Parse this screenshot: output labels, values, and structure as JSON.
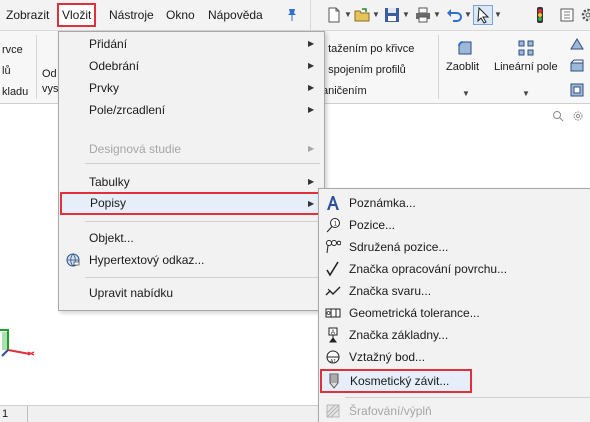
{
  "menubar": {
    "items": [
      {
        "label": "Zobrazit"
      },
      {
        "label": "Vložit"
      },
      {
        "label": "Nástroje"
      },
      {
        "label": "Okno"
      },
      {
        "label": "Nápověda"
      }
    ]
  },
  "ribbon": {
    "left_fragments": [
      "rvce",
      "lů",
      "kladu"
    ],
    "odv": [
      "Od",
      "vys"
    ],
    "fragments": [
      "í tažením po křivce",
      "í spojením profilů",
      "aničením"
    ],
    "commands": [
      {
        "label": "Zaoblit"
      },
      {
        "label": "Lineární pole"
      }
    ]
  },
  "insert_menu": {
    "items": [
      {
        "label": "Přidání",
        "submenu": true,
        "disabled": false
      },
      {
        "label": "Odebrání",
        "submenu": true,
        "disabled": false
      },
      {
        "label": "Prvky",
        "submenu": true,
        "disabled": false
      },
      {
        "label": "Pole/zrcadlení",
        "submenu": true,
        "disabled": false
      },
      {
        "label": "Designová studie",
        "submenu": true,
        "disabled": true
      },
      {
        "label": "Tabulky",
        "submenu": true,
        "disabled": false
      },
      {
        "label": "Popisy",
        "submenu": true,
        "disabled": false,
        "highlighted": true
      },
      {
        "label": "Objekt...",
        "submenu": false,
        "disabled": false
      },
      {
        "label": "Hypertextový odkaz...",
        "submenu": false,
        "disabled": false
      },
      {
        "label": "Upravit nabídku",
        "submenu": false,
        "disabled": false
      }
    ]
  },
  "annotations_menu": {
    "items": [
      {
        "label": "Poznámka...",
        "icon": "note-icon"
      },
      {
        "label": "Pozice...",
        "icon": "balloon-icon"
      },
      {
        "label": "Sdružená pozice...",
        "icon": "stacked-balloon-icon"
      },
      {
        "label": "Značka opracování povrchu...",
        "icon": "surface-finish-icon"
      },
      {
        "label": "Značka svaru...",
        "icon": "weld-symbol-icon"
      },
      {
        "label": "Geometrická tolerance...",
        "icon": "geometric-tolerance-icon"
      },
      {
        "label": "Značka základny...",
        "icon": "datum-feature-icon"
      },
      {
        "label": "Vztažný bod...",
        "icon": "datum-target-icon"
      },
      {
        "label": "Kosmetický závit...",
        "icon": "cosmetic-thread-icon",
        "highlighted": true
      },
      {
        "label": "Šrafování/výplň",
        "icon": "hatch-icon",
        "disabled": true
      }
    ]
  },
  "statusbar": {
    "cell": "1"
  },
  "colors": {
    "highlight_border": "#e0303a",
    "menu_bg": "#f2f2f2",
    "accent_blue": "#2e6fd4"
  }
}
